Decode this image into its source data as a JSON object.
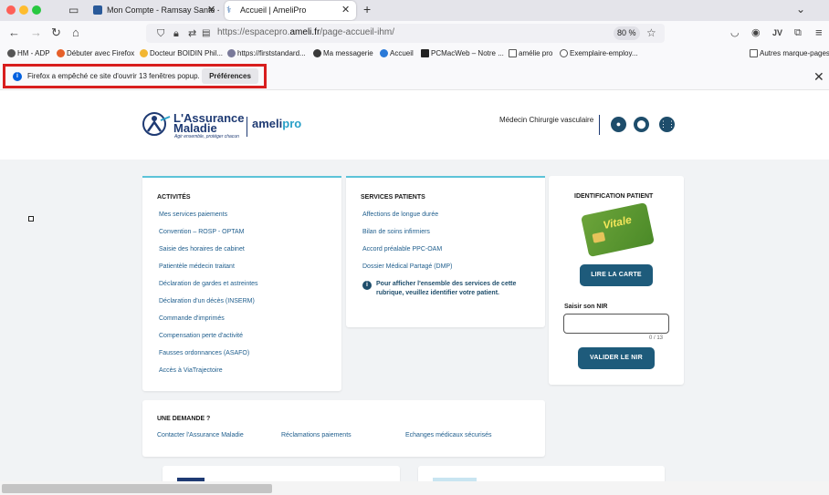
{
  "browser": {
    "tabs": [
      {
        "title": "Mon Compte - Ramsay Santé -"
      },
      {
        "title": "Accueil | AmeliPro"
      }
    ],
    "url_prefix": "https://espacepro.",
    "url_domain": "ameli.fr",
    "url_path": "/page-accueil-ihm/",
    "zoom": "80 %",
    "bookmarks": [
      "HM - ADP",
      "Débuter avec Firefox",
      "Docteur BOIDIN Phil...",
      "https://firststandard...",
      "Ma messagerie",
      "Accueil",
      "PCMacWeb – Notre ...",
      "amélie pro",
      "Exemplaire-employ...",
      "Autres marque-pages"
    ],
    "popup_notice": {
      "message": "Firefox a empêché ce site d'ouvrir 13 fenêtres popup.",
      "button": "Préférences"
    }
  },
  "site": {
    "logo_line1": "L'Assurance",
    "logo_line2": "Maladie",
    "logo_tagline": "Agir ensemble, protéger chacun",
    "brand_prefix": "ameli",
    "brand_suffix": "pro",
    "profile_label": "Médecin Chirurgie vasculaire"
  },
  "activites": {
    "title": "ACTIVITÉS",
    "links": [
      "Mes services paiements",
      "Convention – ROSP - OPTAM",
      "Saisie des horaires de cabinet",
      "Patientèle médecin traitant",
      "Déclaration de gardes et astreintes",
      "Déclaration d'un décès (INSERM)",
      "Commande d'imprimés",
      "Compensation perte d'activité",
      "Fausses ordonnances (ASAFO)",
      "Accès à ViaTrajectoire"
    ]
  },
  "services": {
    "title": "SERVICES PATIENTS",
    "links": [
      "Affections de longue durée",
      "Bilan de soins infirmiers",
      "Accord préalable PPC-OAM",
      "Dossier Médical Partagé (DMP)"
    ],
    "note": "Pour afficher l'ensemble des services de cette rubrique, veuillez identifier votre patient."
  },
  "identification": {
    "title": "IDENTIFICATION PATIENT",
    "card_text": "Vitale",
    "read_card_button": "LIRE LA CARTE",
    "nir_label": "Saisir son NIR",
    "nir_value": "",
    "nir_counter": "0 / 13",
    "validate_button": "VALIDER LE NIR"
  },
  "demande": {
    "title": "UNE DEMANDE ?",
    "links": [
      "Contacter l'Assurance Maladie",
      "Réclamations paiements",
      "Echanges médicaux sécurisés"
    ]
  }
}
